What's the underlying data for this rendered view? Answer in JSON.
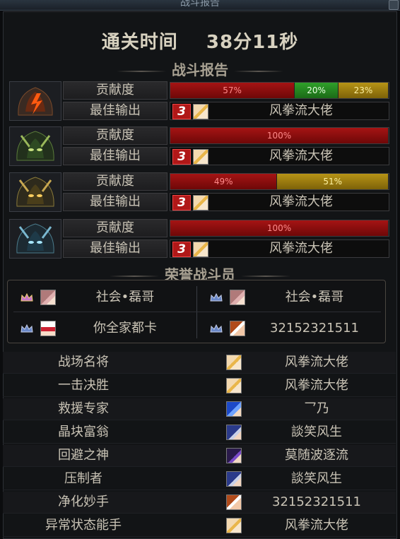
{
  "window": {
    "title": "战斗报告"
  },
  "clear_time": {
    "label": "通关时间",
    "value": "38分11秒"
  },
  "sections": {
    "report": "战斗报告",
    "honor": "荣誉战斗员"
  },
  "labels": {
    "contribution": "贡献度",
    "best_output": "最佳输出"
  },
  "bosses": [
    {
      "icon": "fire-demon-icon",
      "best_rank": "3",
      "best_name": "风拳流大佬",
      "segments": [
        {
          "label": "57%",
          "value": 57,
          "color": "red"
        },
        {
          "label": "20%",
          "value": 20,
          "color": "green"
        },
        {
          "label": "23%",
          "value": 23,
          "color": "yellow"
        }
      ]
    },
    {
      "icon": "green-demon-icon",
      "best_rank": "3",
      "best_name": "风拳流大佬",
      "segments": [
        {
          "label": "100%",
          "value": 100,
          "color": "red"
        }
      ]
    },
    {
      "icon": "gold-demon-icon",
      "best_rank": "3",
      "best_name": "风拳流大佬",
      "segments": [
        {
          "label": "49%",
          "value": 49,
          "color": "red"
        },
        {
          "label": "51%",
          "value": 51,
          "color": "yellow"
        }
      ]
    },
    {
      "icon": "ice-demon-icon",
      "best_rank": "3",
      "best_name": "风拳流大佬",
      "segments": [
        {
          "label": "100%",
          "value": 100,
          "color": "red"
        }
      ]
    }
  ],
  "honor": [
    {
      "name": "社会•磊哥"
    },
    {
      "name": "社会•磊哥"
    },
    {
      "name": "你全家都卡"
    },
    {
      "name": "32152321511"
    }
  ],
  "awards": [
    {
      "title": "战场名将",
      "name": "风拳流大佬"
    },
    {
      "title": "一击决胜",
      "name": "风拳流大佬"
    },
    {
      "title": "救援专家",
      "name": "乛乃"
    },
    {
      "title": "晶块富翁",
      "name": "談笑风生"
    },
    {
      "title": "回避之神",
      "name": "莫随波逐流"
    },
    {
      "title": "压制者",
      "name": "談笑风生"
    },
    {
      "title": "净化妙手",
      "name": "32152321511"
    },
    {
      "title": "异常状态能手",
      "name": "风拳流大佬"
    }
  ]
}
